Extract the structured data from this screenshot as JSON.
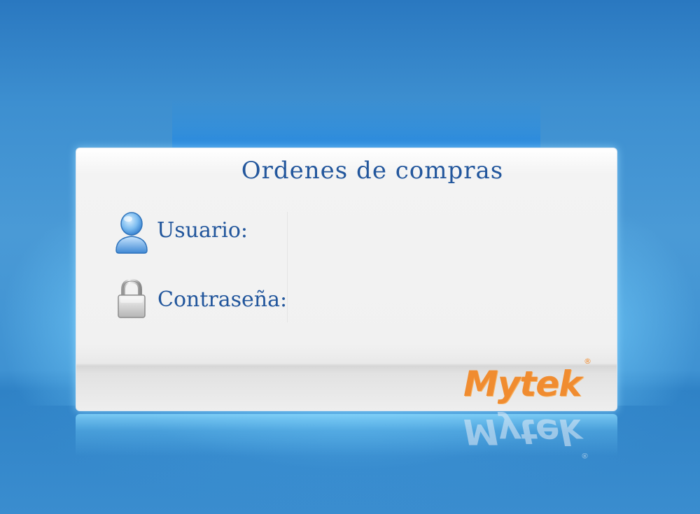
{
  "app": {
    "title": "Ordenes de compras"
  },
  "login": {
    "user_label": "Usuario:",
    "user_value": "",
    "user_icon": "user-icon",
    "password_label": "Contraseña:",
    "password_value": "",
    "password_icon": "lock-icon"
  },
  "brand": {
    "logo_text": "Mytek",
    "registered_mark": "®",
    "logo_color": "#f08c30"
  },
  "colors": {
    "background": "#3d8fd0",
    "panel": "#f1f1f1",
    "text": "#22569c"
  }
}
